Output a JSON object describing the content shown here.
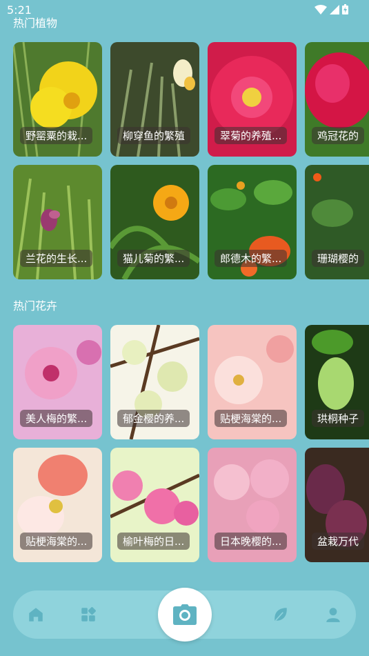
{
  "status_bar": {
    "time": "5:21"
  },
  "sections": [
    {
      "title": "热门植物",
      "cards": [
        {
          "label": "野罂粟的栽..."
        },
        {
          "label": "柳穿鱼的繁殖"
        },
        {
          "label": "翠菊的养殖..."
        },
        {
          "label": "鸡冠花的"
        },
        {
          "label": "兰花的生长..."
        },
        {
          "label": "猫儿菊的繁..."
        },
        {
          "label": "郎德木的繁..."
        },
        {
          "label": "珊瑚樱的"
        }
      ]
    },
    {
      "title": "热门花卉",
      "cards": [
        {
          "label": "美人梅的繁..."
        },
        {
          "label": "郁金樱的养..."
        },
        {
          "label": "贴梗海棠的..."
        },
        {
          "label": "珙桐种子"
        },
        {
          "label": "贴梗海棠的..."
        },
        {
          "label": "榆叶梅的日..."
        },
        {
          "label": "日本晚樱的..."
        },
        {
          "label": "盆栽万代"
        }
      ]
    }
  ],
  "nav": {
    "items": [
      "home-icon",
      "apps-icon",
      "camera-icon",
      "leaf-icon",
      "profile-icon"
    ],
    "accent": "#5fb3c2"
  }
}
